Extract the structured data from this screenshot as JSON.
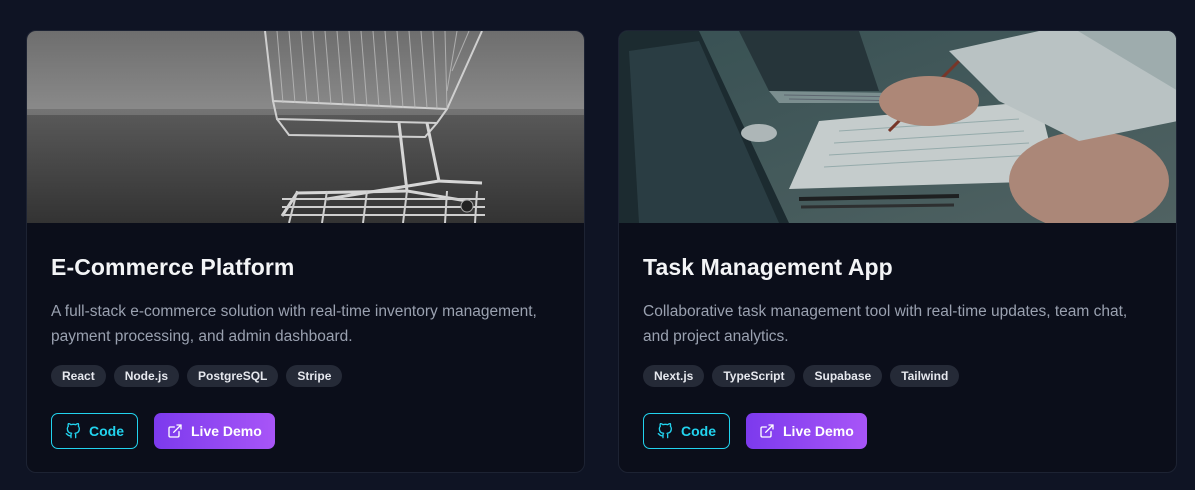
{
  "projects": [
    {
      "title": "E-Commerce Platform",
      "description_line1": "A full-stack e-commerce solution with real-time inventory management,",
      "description_line2": "payment processing, and admin dashboard.",
      "tags": [
        "React",
        "Node.js",
        "PostgreSQL",
        "Stripe"
      ],
      "code_label": "Code",
      "demo_label": "Live Demo",
      "image": "shopping-cart-photo"
    },
    {
      "title": "Task Management App",
      "description_line1": "Collaborative task management tool with real-time updates, team chat,",
      "description_line2": "and project analytics.",
      "tags": [
        "Next.js",
        "TypeScript",
        "Supabase",
        "Tailwind"
      ],
      "code_label": "Code",
      "demo_label": "Live Demo",
      "image": "laptop-paperwork-photo"
    }
  ],
  "icons": {
    "code": "github-icon",
    "demo": "external-link-icon"
  },
  "colors": {
    "background": "#0f1424",
    "card": "#0b0e1a",
    "accent_cyan": "#22d3ee",
    "accent_purple": "#a855f7"
  }
}
